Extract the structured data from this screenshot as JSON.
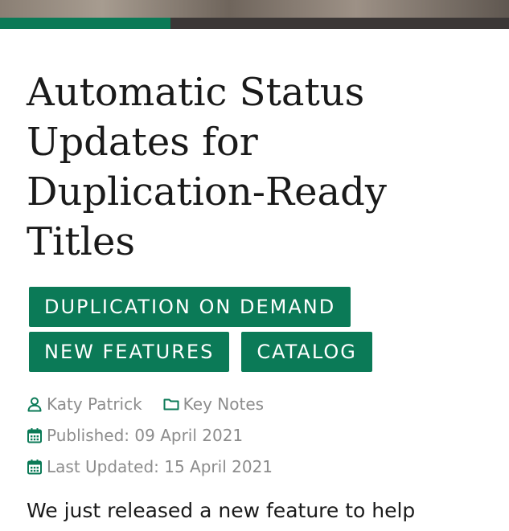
{
  "header": {
    "reading_progress": 0.335
  },
  "article": {
    "title": "Automatic Status Updates for Duplication-Ready Titles",
    "tags": [
      "DUPLICATION ON DEMAND",
      "NEW FEATURES",
      "CATALOG"
    ],
    "author": "Katy Patrick",
    "category": "Key Notes",
    "published": "Published: 09 April 2021",
    "last_updated": "Last Updated: 15 April 2021",
    "intro": "We just released a new feature to help"
  },
  "colors": {
    "accent": "#0b7a57",
    "muted_text": "#8c8c8c",
    "body_text": "#1a1a1a"
  },
  "icons": {
    "author": "user-icon",
    "category": "folder-icon",
    "published": "calendar-icon",
    "updated": "calendar-icon"
  }
}
